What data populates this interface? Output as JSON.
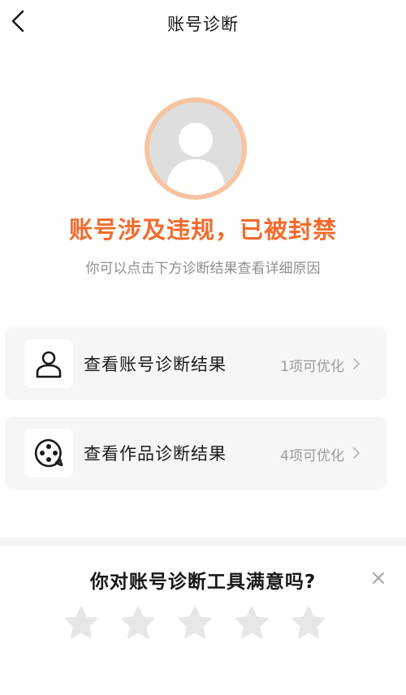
{
  "header": {
    "title": "账号诊断",
    "back_icon": "chevron-left-icon"
  },
  "status": {
    "avatar_icon": "default-avatar-icon",
    "headline": "账号涉及违规，已被封禁",
    "subtext": "你可以点击下方诊断结果查看详细原因",
    "accent_color": "#f26c2e"
  },
  "cards": [
    {
      "icon": "user-icon",
      "label": "查看账号诊断结果",
      "meta": "1项可优化"
    },
    {
      "icon": "film-reel-icon",
      "label": "查看作品诊断结果",
      "meta": "4项可优化"
    }
  ],
  "survey": {
    "question": "你对账号诊断工具满意吗?",
    "close_icon": "close-icon",
    "rating": 0,
    "max_rating": 5
  }
}
